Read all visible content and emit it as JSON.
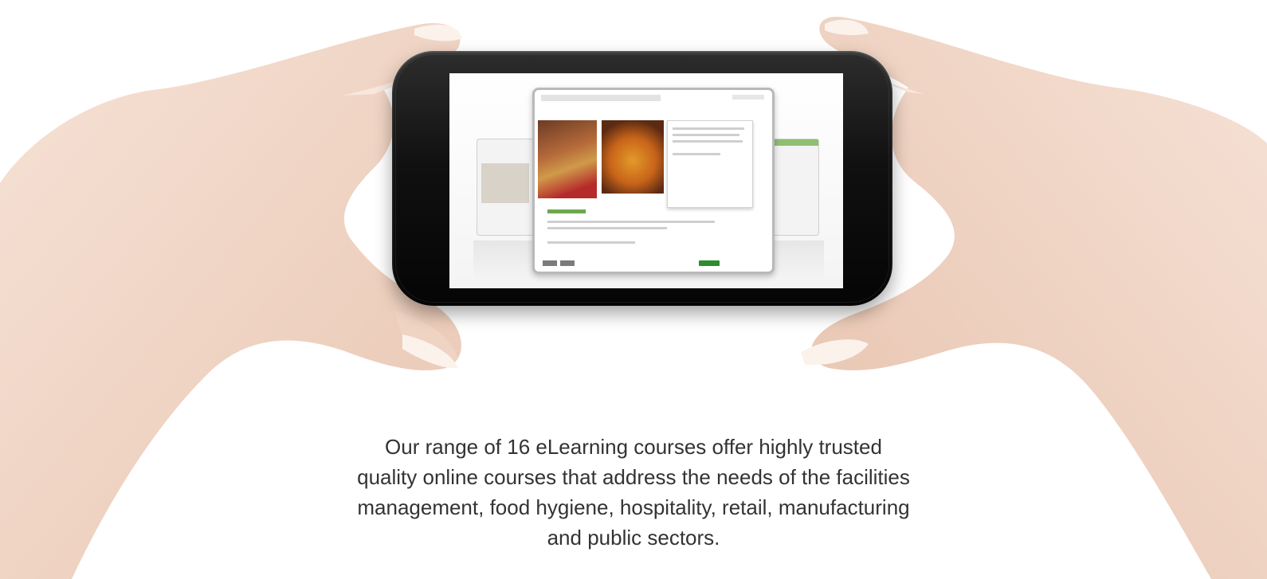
{
  "image": {
    "caption_lines": [
      "Our range of 16 eLearning courses offer highly trusted",
      "quality online courses that address the needs of the facilities",
      "management, food hygiene, hospitality, retail, manufacturing",
      "and public sectors."
    ],
    "colors": {
      "background": "#ffffff",
      "skin": "#f1d7c8",
      "phone_body": "#111111",
      "caption_text": "#333333",
      "course_accent": "#2e8b2e"
    }
  }
}
